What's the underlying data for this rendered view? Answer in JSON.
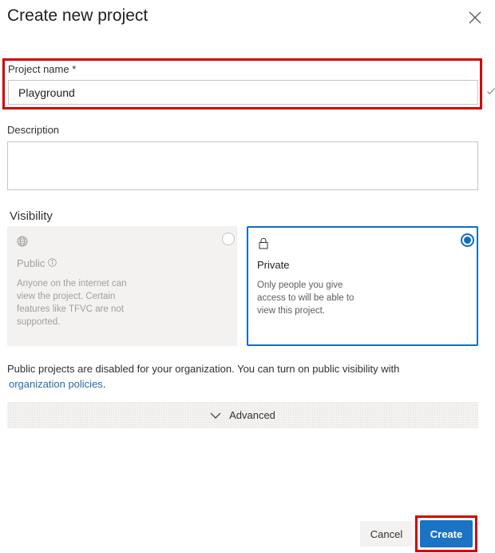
{
  "dialog": {
    "title": "Create new project",
    "close_icon": "close-icon"
  },
  "project_name": {
    "label": "Project name *",
    "value": "Playground",
    "valid_icon": "checkmark-icon"
  },
  "description": {
    "label": "Description",
    "value": "",
    "placeholder": ""
  },
  "visibility": {
    "label": "Visibility",
    "options": [
      {
        "title": "Public",
        "icon": "globe-icon",
        "info_icon": "info-icon",
        "description": "Anyone on the internet can view the project. Certain features like TFVC are not supported.",
        "selected": false,
        "disabled": true
      },
      {
        "title": "Private",
        "icon": "lock-icon",
        "description": "Only people you give access to will be able to view this project.",
        "selected": true,
        "disabled": false
      }
    ]
  },
  "notice": {
    "text": "Public projects are disabled for your organization. You can turn on public visibility with ",
    "link": "organization policies",
    "suffix": "."
  },
  "advanced": {
    "label": "Advanced",
    "icon": "chevron-down-icon"
  },
  "footer": {
    "cancel_label": "Cancel",
    "create_label": "Create"
  },
  "colors": {
    "highlight": "#d40000",
    "accent": "#106ebe",
    "primary_button": "#1a73c3",
    "link": "#2b6aa8"
  }
}
